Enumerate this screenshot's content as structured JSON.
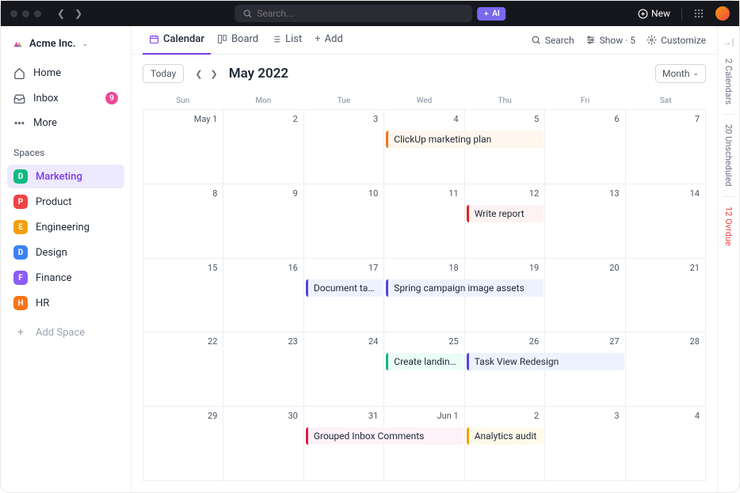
{
  "titlebar": {
    "search_placeholder": "Search...",
    "ai_label": "AI",
    "new_label": "New"
  },
  "workspace": {
    "name": "Acme Inc."
  },
  "nav": [
    {
      "icon": "home",
      "label": "Home"
    },
    {
      "icon": "inbox",
      "label": "Inbox",
      "badge": "9"
    },
    {
      "icon": "more",
      "label": "More"
    }
  ],
  "spaces_title": "Spaces",
  "spaces": [
    {
      "letter": "D",
      "color": "#10b981",
      "label": "Marketing",
      "active": true
    },
    {
      "letter": "P",
      "color": "#ef4444",
      "label": "Product"
    },
    {
      "letter": "E",
      "color": "#f59e0b",
      "label": "Engineering"
    },
    {
      "letter": "D",
      "color": "#3b82f6",
      "label": "Design"
    },
    {
      "letter": "F",
      "color": "#8b5cf6",
      "label": "Finance"
    },
    {
      "letter": "H",
      "color": "#f97316",
      "label": "HR"
    }
  ],
  "add_space": "Add Space",
  "views": [
    {
      "icon": "calendar",
      "label": "Calendar",
      "active": true
    },
    {
      "icon": "board",
      "label": "Board"
    },
    {
      "icon": "list",
      "label": "List"
    },
    {
      "icon": "plus",
      "label": "Add"
    }
  ],
  "tools": {
    "search": "Search",
    "show": "Show · 5",
    "customize": "Customize"
  },
  "calendar": {
    "today": "Today",
    "month_title": "May 2022",
    "view_mode": "Month",
    "day_headers": [
      "Sun",
      "Mon",
      "Tue",
      "Wed",
      "Thu",
      "Fri",
      "Sat"
    ],
    "weeks": [
      [
        "May 1",
        "2",
        "3",
        "4",
        "5",
        "6",
        "7"
      ],
      [
        "8",
        "9",
        "10",
        "11",
        "12",
        "13",
        "14"
      ],
      [
        "15",
        "16",
        "17",
        "18",
        "19",
        "20",
        "21"
      ],
      [
        "22",
        "23",
        "24",
        "25",
        "26",
        "27",
        "28"
      ],
      [
        "29",
        "30",
        "31",
        "Jun 1",
        "2",
        "3",
        "4"
      ]
    ],
    "events": [
      {
        "week": 0,
        "start": 3,
        "span": 2,
        "label": "ClickUp marketing plan",
        "color": "#f97316",
        "bg": "#fff7ed"
      },
      {
        "week": 1,
        "start": 4,
        "span": 1,
        "label": "Write report",
        "color": "#dc2626",
        "bg": "#fef2f2"
      },
      {
        "week": 2,
        "start": 2,
        "span": 1,
        "label": "Document target users",
        "color": "#4f46e5",
        "bg": "#eef2ff"
      },
      {
        "week": 2,
        "start": 3,
        "span": 2,
        "label": "Spring campaign image assets",
        "color": "#4f46e5",
        "bg": "#eef2ff"
      },
      {
        "week": 3,
        "start": 3,
        "span": 1,
        "label": "Create landing page",
        "color": "#10b981",
        "bg": "#ecfdf5"
      },
      {
        "week": 3,
        "start": 4,
        "span": 2,
        "label": "Task View Redesign",
        "color": "#4f46e5",
        "bg": "#eef2ff"
      },
      {
        "week": 4,
        "start": 2,
        "span": 2,
        "label": "Grouped Inbox Comments",
        "color": "#e11d48",
        "bg": "#fdf2f8"
      },
      {
        "week": 4,
        "start": 4,
        "span": 1,
        "label": "Analytics audit",
        "color": "#f59e0b",
        "bg": "#fffbeb"
      }
    ]
  },
  "side_panel": {
    "calendars": "2 Calendars",
    "unscheduled": "20 Unscheduled",
    "overdue": "12 Ovrdue"
  }
}
